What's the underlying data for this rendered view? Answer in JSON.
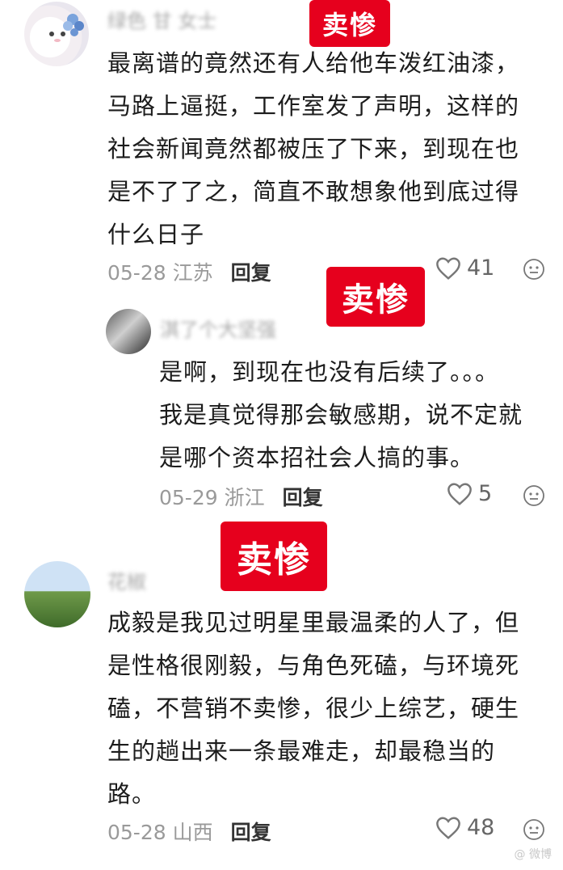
{
  "comments": [
    {
      "username": "绿色 甘 女士",
      "text_lines": [
        "最离谱的竟然还有人给他车泼红油漆，",
        "马路上逼挺，工作室发了声明，这样的",
        "社会新闻竟然都被压了下来，到现在也",
        "是不了了之，简直不敢想象他到底过得",
        "什么日子"
      ],
      "date": "05-28",
      "location": "江苏",
      "reply": "回复",
      "likes": "41",
      "stamp": "卖惨"
    },
    {
      "username": "淇了个大坚强",
      "text_lines": [
        "是啊，到现在也没有后续了。。。",
        "我是真觉得那会敏感期，说不定就",
        "是哪个资本招社会人搞的事。"
      ],
      "date": "05-29",
      "location": "浙江",
      "reply": "回复",
      "likes": "5",
      "stamp": "卖惨"
    },
    {
      "username": "花椒",
      "text_lines": [
        "成毅是我见过明星里最温柔的人了，但",
        "是性格很刚毅，与角色死磕，与环境死",
        "磕，不营销不卖惨，很少上综艺，硬生",
        "生的趟出来一条最难走，却最稳当的",
        "路。"
      ],
      "date": "05-28",
      "location": "山西",
      "reply": "回复",
      "likes": "48",
      "stamp": "卖惨"
    }
  ],
  "watermark": "@ 微博"
}
